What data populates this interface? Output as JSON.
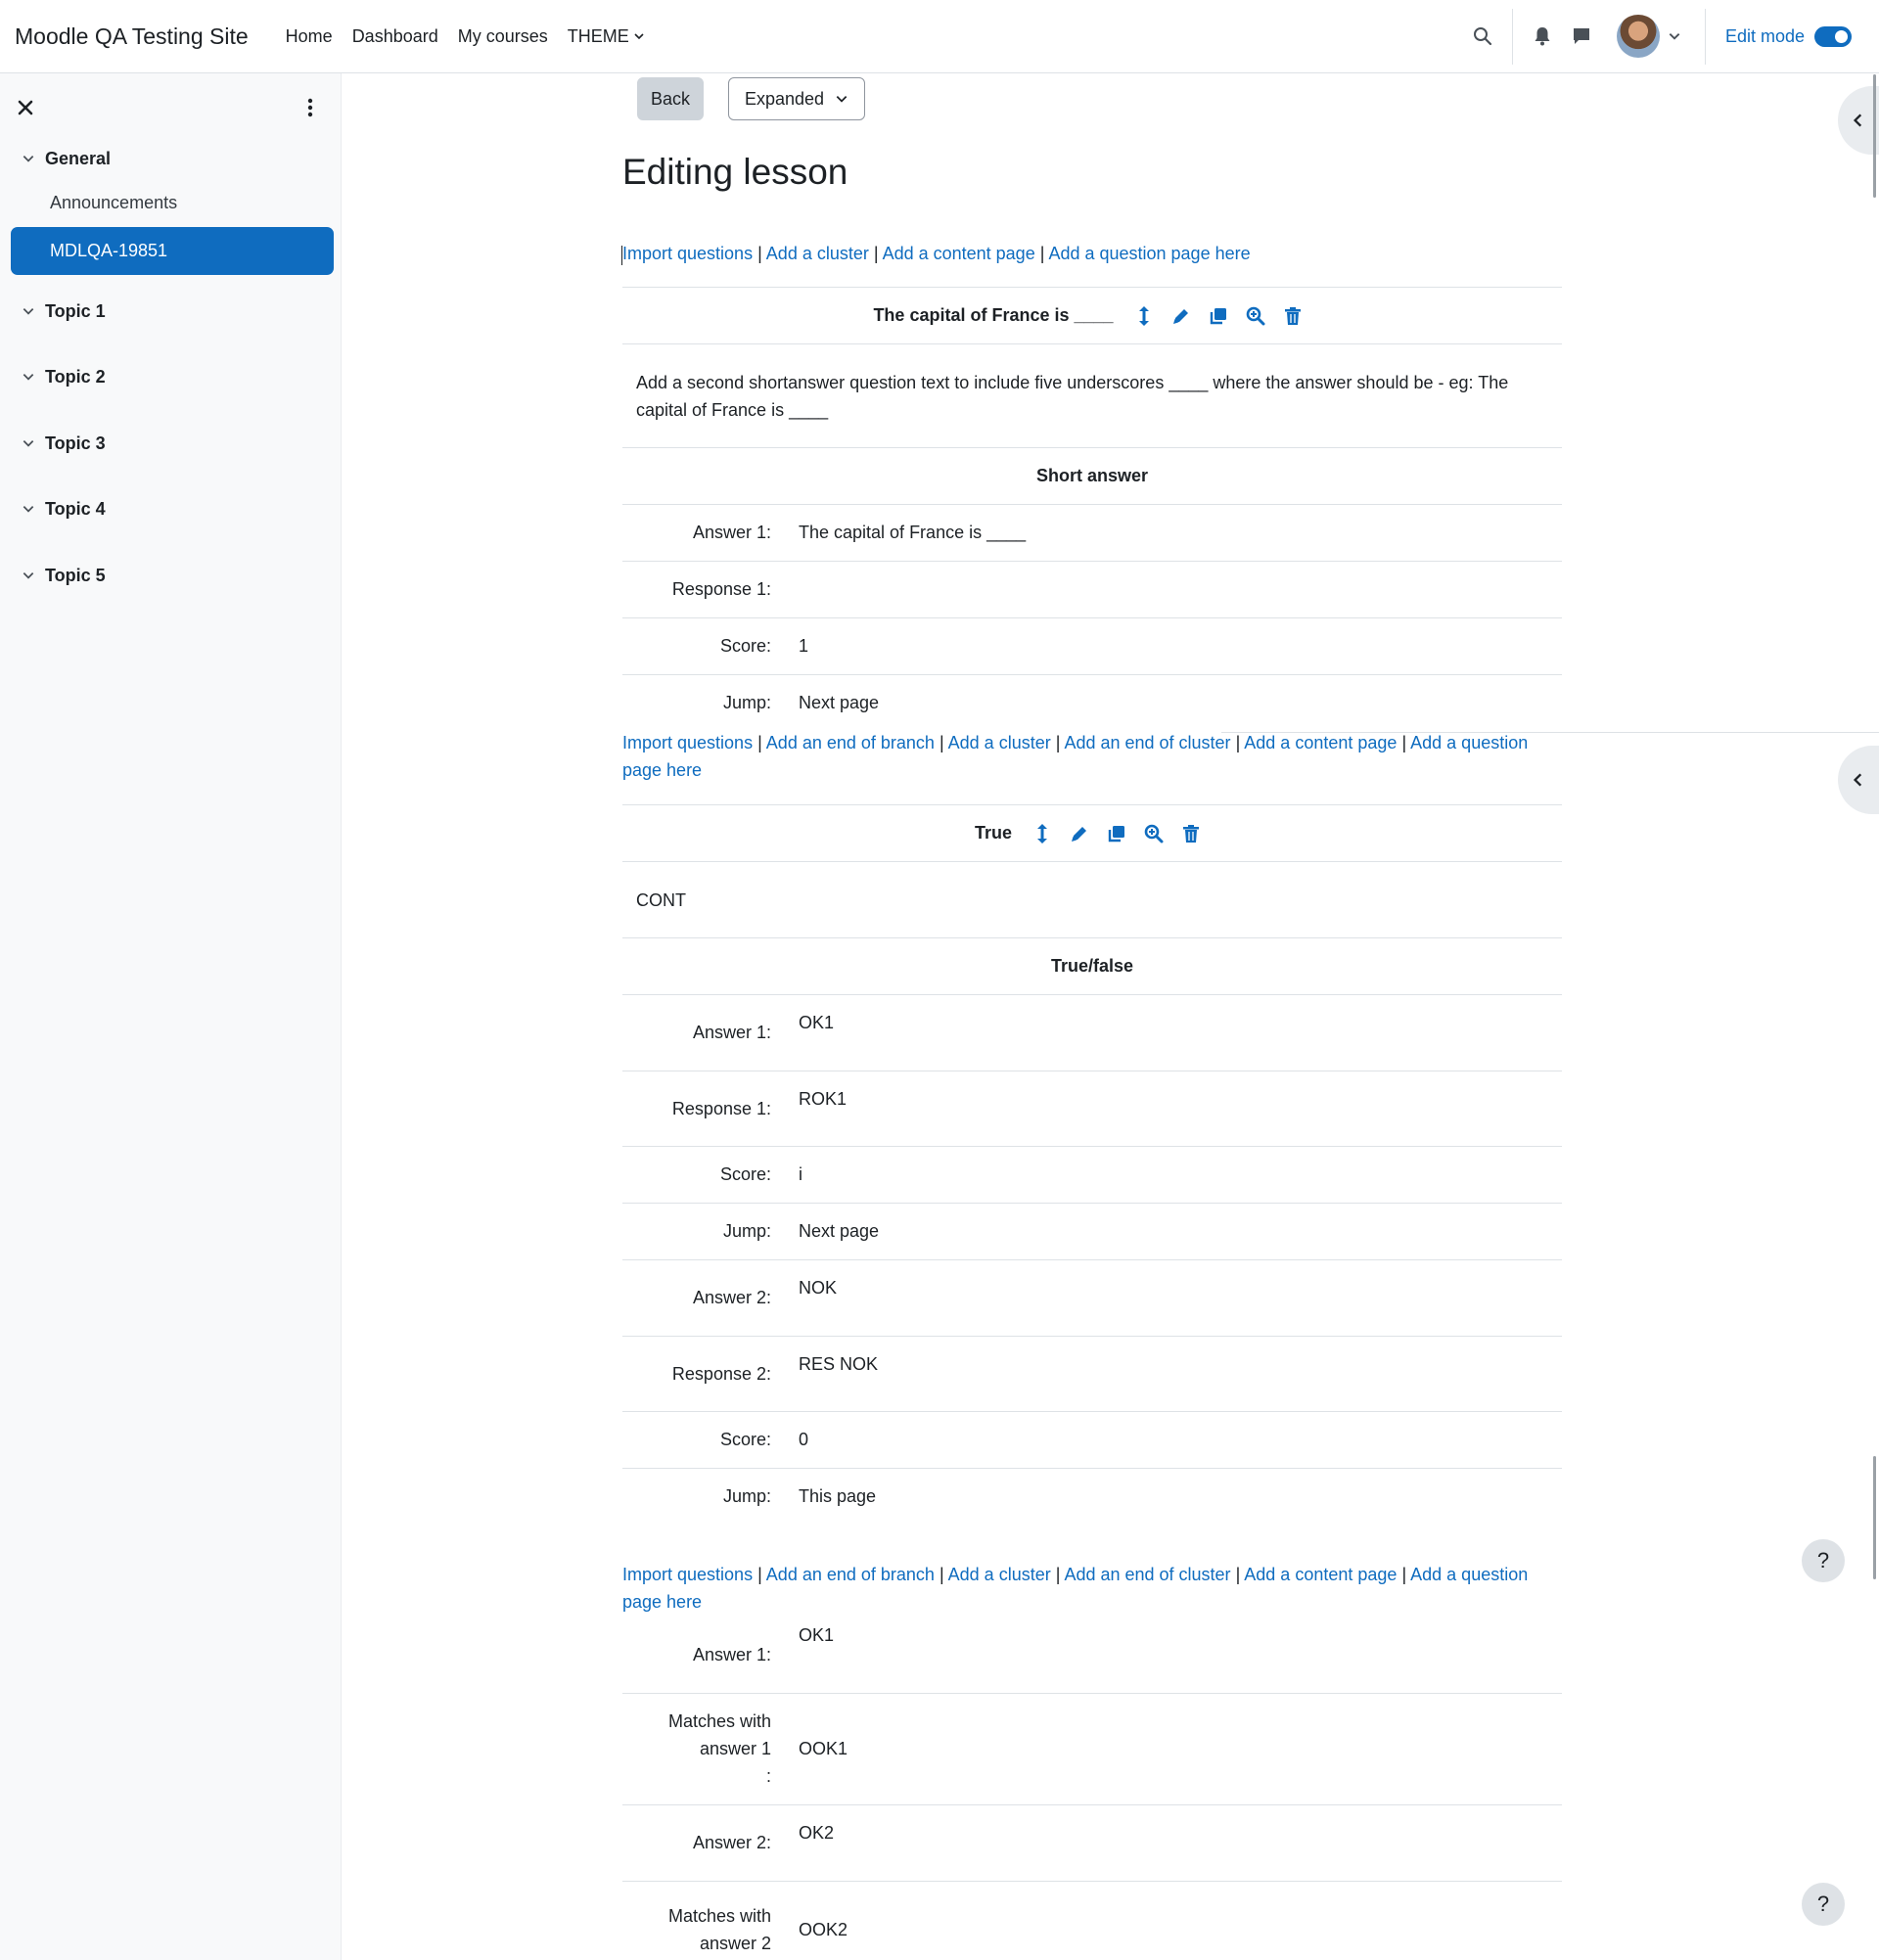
{
  "navbar": {
    "brand": "Moodle QA Testing Site",
    "links": [
      "Home",
      "Dashboard",
      "My courses",
      "THEME"
    ],
    "edit_mode_label": "Edit mode",
    "icons": [
      "search-icon",
      "bell-icon",
      "message-icon",
      "avatar",
      "chevron-down-icon"
    ]
  },
  "drawer": {
    "sections": [
      {
        "label": "General"
      },
      {
        "label": "Topic 1"
      },
      {
        "label": "Topic 2"
      },
      {
        "label": "Topic 3"
      },
      {
        "label": "Topic 4"
      },
      {
        "label": "Topic 5"
      }
    ],
    "items": [
      "Announcements",
      "MDLQA-19851"
    ]
  },
  "main": {
    "back_label": "Back",
    "view_select": "Expanded",
    "title": "Editing lesson",
    "links_short": [
      "Import questions",
      "Add a cluster",
      "Add a content page",
      "Add a question page here"
    ],
    "links_long": [
      "Import questions",
      "Add an end of branch",
      "Add a cluster",
      "Add an end of cluster",
      "Add a content page",
      "Add a question page here"
    ],
    "separator": "|",
    "pages": [
      {
        "title": "The capital of France is ____",
        "content": "Add a second shortanswer question text to include five underscores ____ where the answer should be - eg: The capital of France is ____",
        "type": "Short answer",
        "rows": [
          {
            "label": "Answer 1:",
            "value": "The capital of France is ____"
          },
          {
            "label": "Response 1:",
            "value": ""
          },
          {
            "label": "Score:",
            "value": "1"
          },
          {
            "label": "Jump:",
            "value": "Next page"
          }
        ]
      },
      {
        "title": "True",
        "content": "CONT",
        "type": "True/false",
        "rows": [
          {
            "label": "Answer 1:",
            "value": "OK1"
          },
          {
            "label": "Response 1:",
            "value": "ROK1"
          },
          {
            "label": "Score:",
            "value": "i"
          },
          {
            "label": "Jump:",
            "value": "Next page"
          },
          {
            "label": "Answer 2:",
            "value": "NOK"
          },
          {
            "label": "Response 2:",
            "value": "RES NOK"
          },
          {
            "label": "Score:",
            "value": "0"
          },
          {
            "label": "Jump:",
            "value": "This page"
          }
        ]
      },
      {
        "rows": [
          {
            "label": "Answer 1:",
            "value": "OK1"
          },
          {
            "label_lines": [
              "Matches with",
              "answer 1",
              ":"
            ],
            "value": "OOK1"
          },
          {
            "label": "Answer 2:",
            "value": "OK2"
          },
          {
            "label_lines": [
              "Matches with",
              "answer 2"
            ],
            "value": "OOK2"
          }
        ]
      }
    ]
  },
  "help_label": "?"
}
